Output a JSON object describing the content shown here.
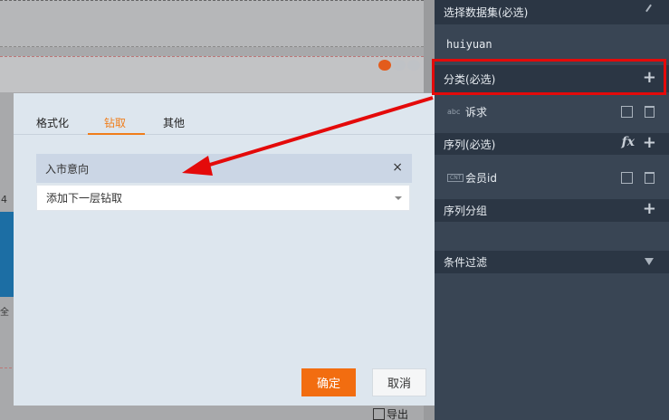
{
  "dialog": {
    "tabs": [
      {
        "label": "格式化"
      },
      {
        "label": "钻取"
      },
      {
        "label": "其他"
      }
    ],
    "active_tab": "钻取",
    "drill_item": "入市意向",
    "drill_close": "×",
    "next_level_placeholder": "添加下一层钻取",
    "ok_label": "确定",
    "cancel_label": "取消"
  },
  "background": {
    "left_number": "4",
    "left_text": "全",
    "export_label": "导出"
  },
  "panel": {
    "dataset_header": "选择数据集(必选)",
    "dataset_value": "huiyuan",
    "category_header": "分类(必选)",
    "category_fields": [
      {
        "type_tag": "abc",
        "label": "诉求"
      }
    ],
    "series_header": "序列(必选)",
    "series_fx": "fx",
    "series_fields": [
      {
        "type_tag": "CNT",
        "label": "会员id"
      }
    ],
    "series_group_header": "序列分组",
    "filter_header": "条件过滤",
    "plus_icon": "+"
  },
  "colors": {
    "accent_orange": "#f26d10",
    "highlight_red": "#e40a0a",
    "panel_bg": "#394554",
    "panel_header_bg": "#2b3644"
  }
}
